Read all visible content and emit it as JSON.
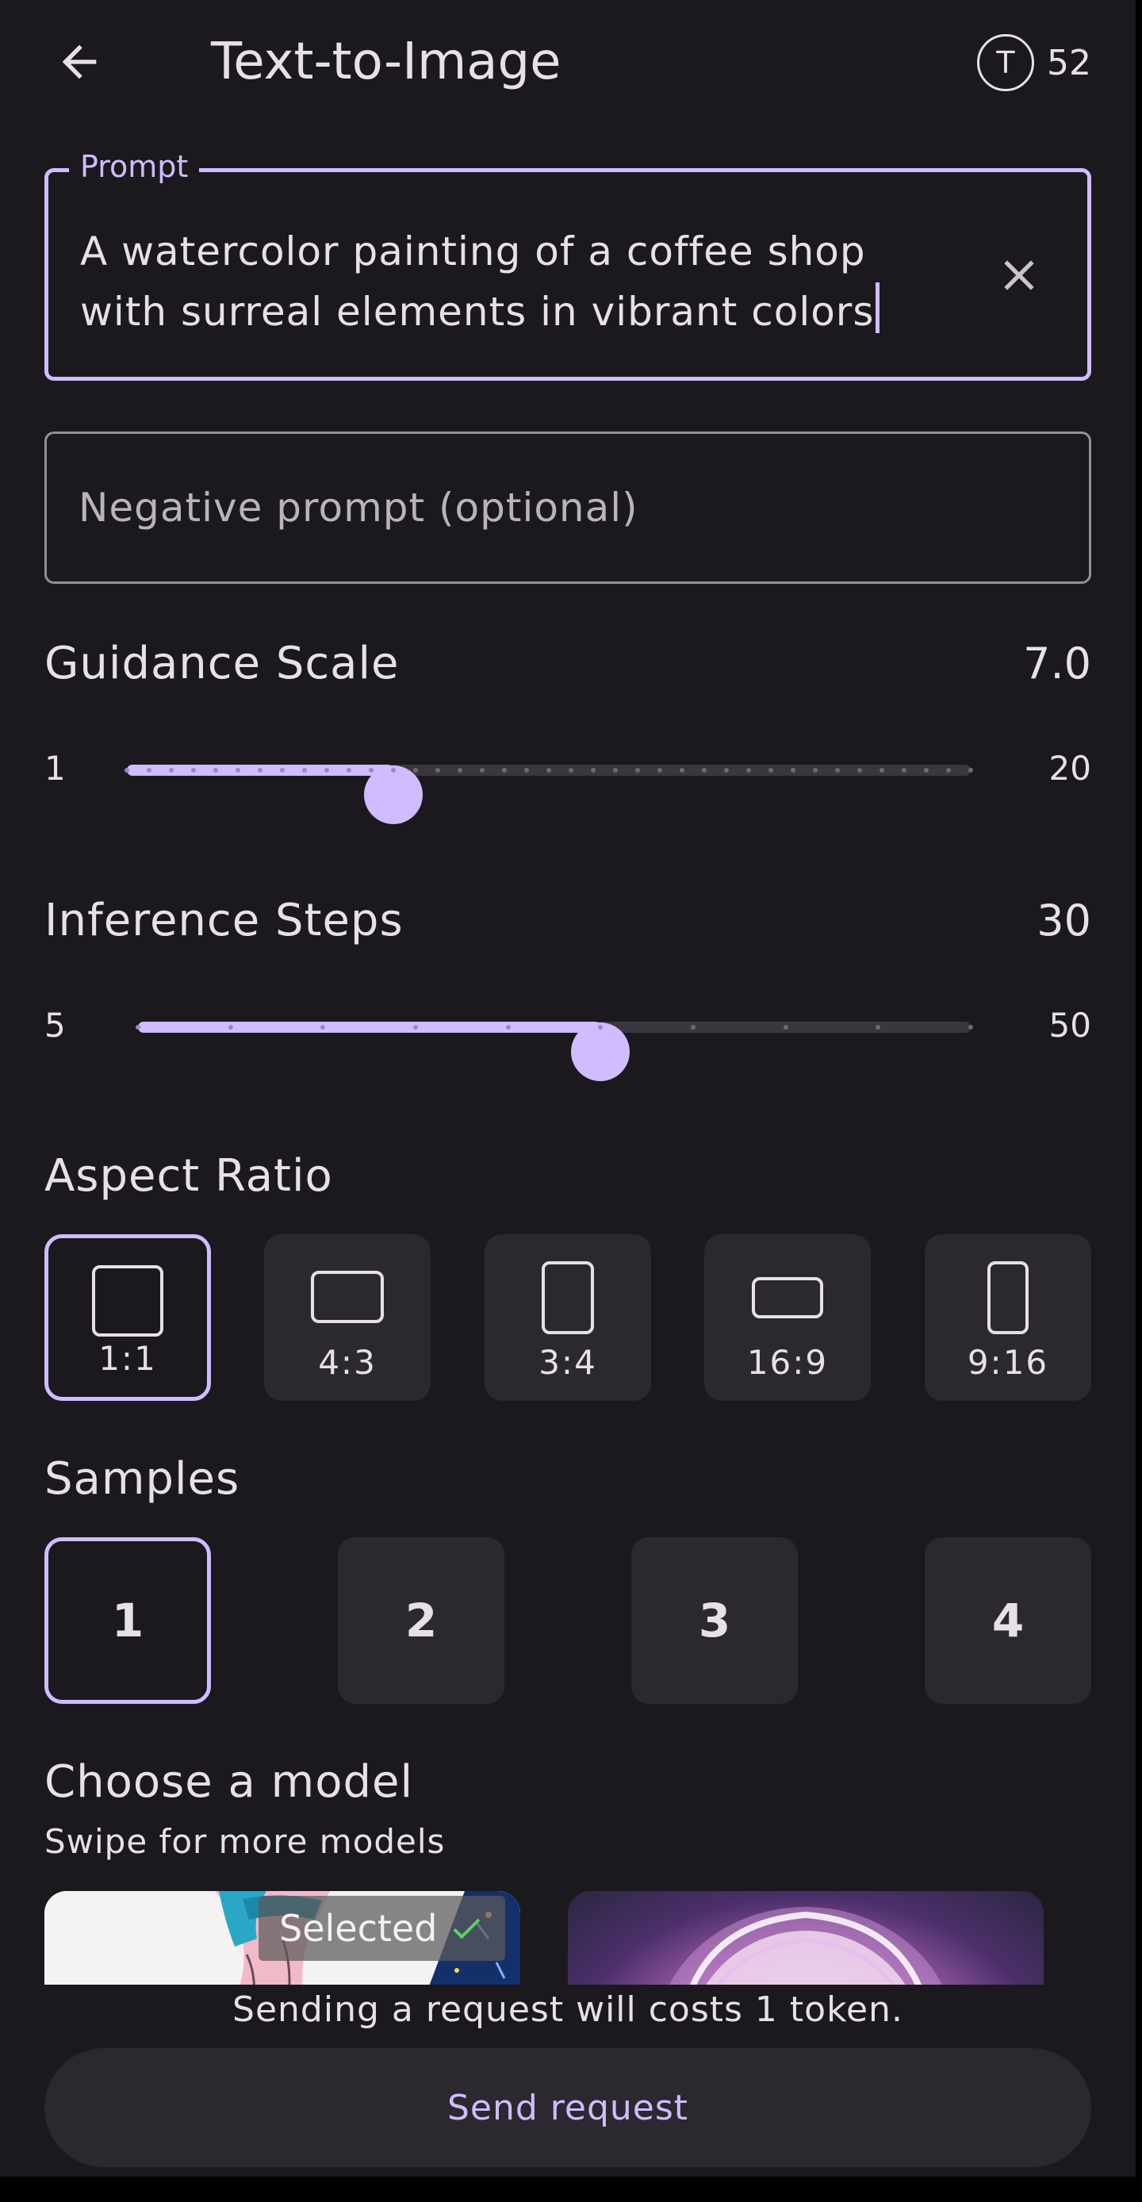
{
  "app": {
    "title": "Text-to-Image",
    "token_icon_letter": "T",
    "token_count": "52"
  },
  "prompt": {
    "label": "Prompt",
    "value": "A watercolor painting of a coffee shop with surreal elements in vibrant colors"
  },
  "negative_prompt": {
    "placeholder": "Negative prompt (optional)",
    "value": ""
  },
  "guidance": {
    "label": "Guidance Scale",
    "value_text": "7.0",
    "min": "1",
    "max": "20",
    "value": 7.0
  },
  "steps": {
    "label": "Inference Steps",
    "value_text": "30",
    "min": "5",
    "max": "50",
    "value": 30
  },
  "aspect_ratio": {
    "label": "Aspect Ratio",
    "selected": "1:1",
    "options": [
      "1:1",
      "4:3",
      "3:4",
      "16:9",
      "9:16"
    ]
  },
  "samples": {
    "label": "Samples",
    "selected": "1",
    "options": [
      "1",
      "2",
      "3",
      "4"
    ]
  },
  "models": {
    "title": "Choose a model",
    "subtitle": "Swipe for more models",
    "selected_badge": "Selected"
  },
  "footer": {
    "cost_text": "Sending a request will costs 1 token.",
    "send_label": "Send request"
  },
  "colors": {
    "accent": "#d0bcff",
    "background": "#1b191e",
    "surface": "#2b292f"
  }
}
